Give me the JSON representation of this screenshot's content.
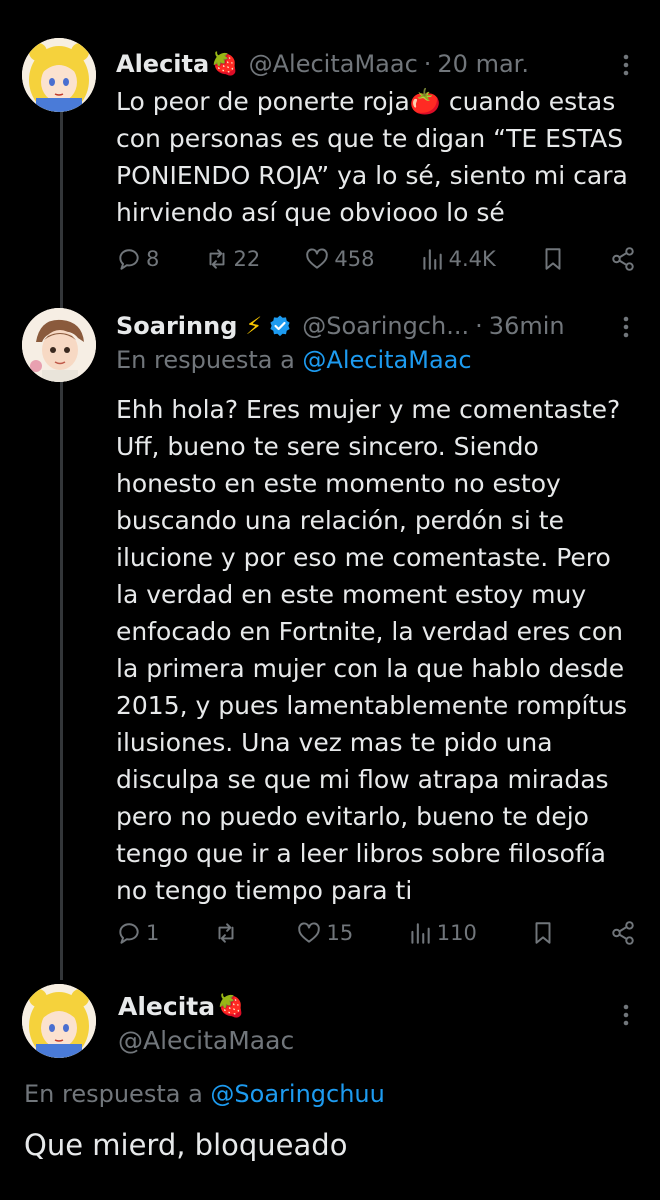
{
  "tweet1": {
    "name": "Alecita",
    "name_emoji": "🍓",
    "handle": "@AlecitaMaac",
    "separator": "·",
    "time": "20 mar.",
    "text": "Lo peor de ponerte roja🍅 cuando estas\ncon personas es que te digan “TE ESTAS\nPONIENDO ROJA” ya lo sé, siento mi cara\nhirviendo así que obviooo lo sé",
    "replies": "8",
    "retweets": "22",
    "likes": "458",
    "views": "4.4K"
  },
  "tweet2": {
    "name": "Soarinng",
    "name_emoji": "⚡",
    "handle": "@Soaringch...",
    "separator": "·",
    "time": "36min",
    "reply_prefix": "En respuesta a",
    "reply_to": "@AlecitaMaac",
    "text": "Ehh hola? Eres mujer y me comentaste?\nUff, bueno te sere sincero. Siendo\nhonesto en este momento no estoy\nbuscando una relación, perdón si te\nilucione y por eso me comentaste. Pero\nla verdad en este moment estoy muy\nenfocado en Fortnite, la verdad eres con\nla primera mujer con la que hablo desde\n2015, y pues lamentablemente rompítus\nilusiones. Una vez mas te pido una\ndisculpa se que mi flow atrapa miradas\npero no puedo evitarlo, bueno te dejo\ntengo que ir a leer libros sobre filosofía\nno tengo tiempo para ti",
    "replies": "1",
    "retweets": "",
    "likes": "15",
    "views": "110"
  },
  "main_tweet": {
    "name": "Alecita",
    "name_emoji": "🍓",
    "handle": "@AlecitaMaac",
    "reply_prefix": "En respuesta a",
    "reply_to": "@Soaringchuu",
    "text": "Que mierd, bloqueado"
  },
  "colors": {
    "background": "#000000",
    "text": "#e7e9ea",
    "muted": "#71767b",
    "link": "#1d9bf0",
    "verified": "#1d9bf0"
  },
  "icons": [
    "reply-icon",
    "retweet-icon",
    "like-icon",
    "views-icon",
    "bookmark-icon",
    "share-icon",
    "more-icon",
    "verified-icon"
  ]
}
